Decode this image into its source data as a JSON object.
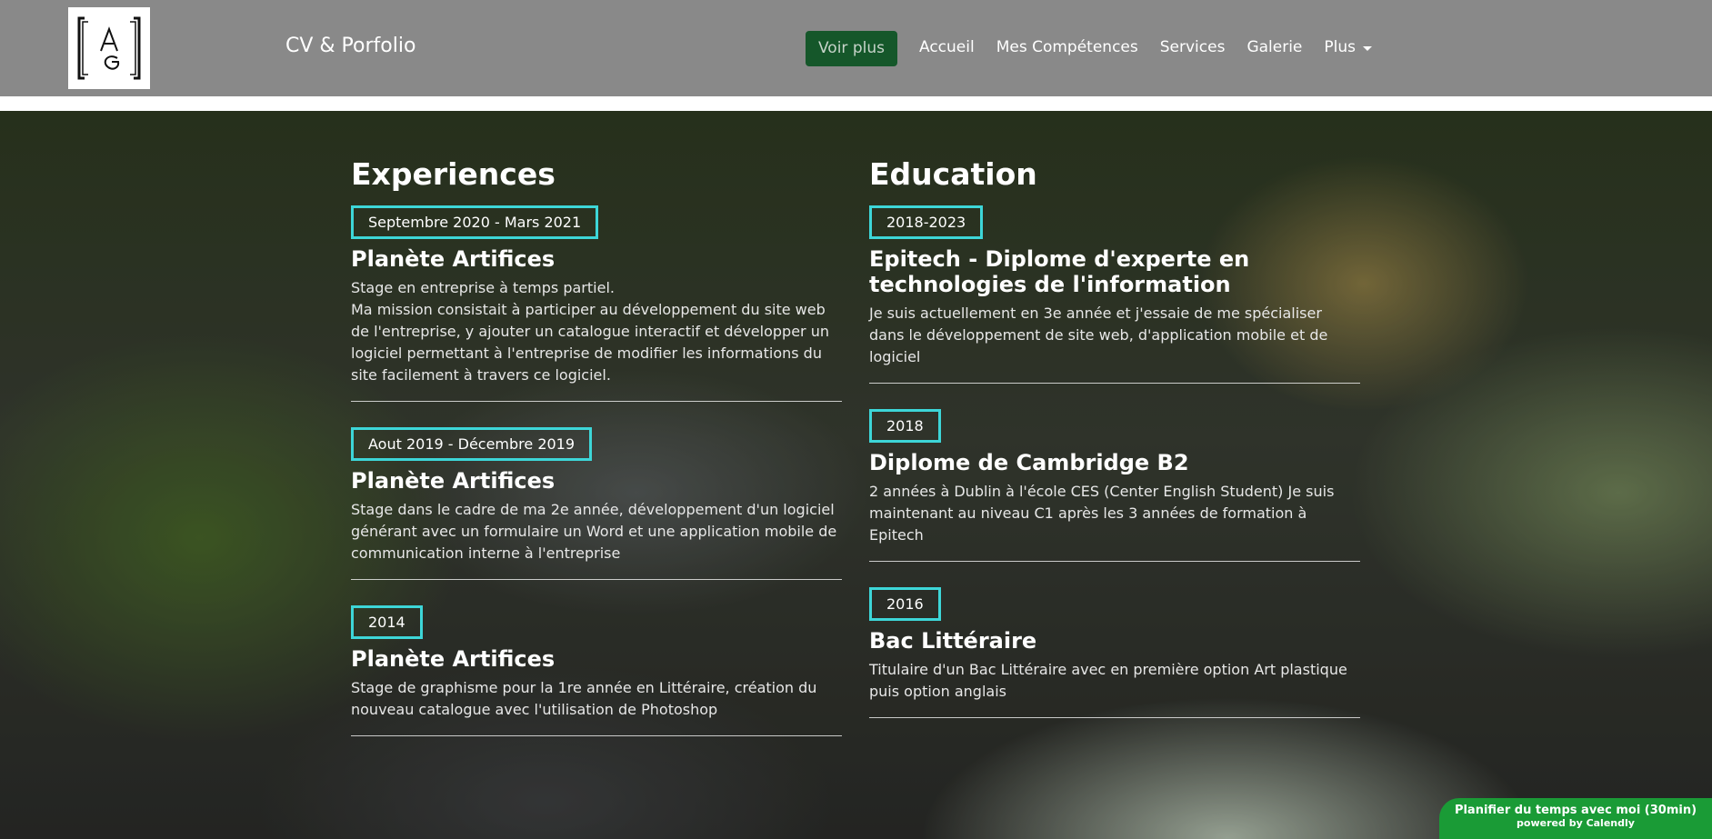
{
  "header": {
    "brand": "CV & Porfolio",
    "cta_label": "Voir plus",
    "nav": [
      "Accueil",
      "Mes Compétences",
      "Services",
      "Galerie"
    ],
    "more_label": "Plus",
    "logo_text": "AG"
  },
  "experiences": {
    "title": "Experiences",
    "items": [
      {
        "date": "Septembre 2020 - Mars 2021",
        "company": "Planète Artifices",
        "desc1": "Stage en entreprise à temps partiel.",
        "desc2": "Ma mission consistait à participer au développement du site web de l'entreprise, y ajouter un catalogue interactif et développer un logiciel permettant à l'entreprise de modifier les informations du site facilement à travers ce logiciel."
      },
      {
        "date": "Aout 2019 - Décembre 2019",
        "company": "Planète Artifices",
        "desc1": "Stage dans le cadre de ma 2e année, développement d'un logiciel générant avec un formulaire un Word et une application mobile de communication interne à l'entreprise"
      },
      {
        "date": "2014",
        "company": "Planète Artifices",
        "desc1": "Stage de graphisme pour la 1re année en Littéraire, création du nouveau catalogue avec l'utilisation de Photoshop"
      }
    ]
  },
  "education": {
    "title": "Education",
    "items": [
      {
        "date": "2018-2023",
        "school": "Epitech - Diplome d'experte en technologies de l'information",
        "desc": "Je suis actuellement en 3e année et j'essaie de me spécialiser dans le développement de site web, d'application mobile et de logiciel"
      },
      {
        "date": "2018",
        "school": "Diplome de Cambridge B2",
        "desc": "2 années à Dublin à l'école CES (Center English Student) Je suis maintenant au niveau C1 après les 3 années de formation à Epitech"
      },
      {
        "date": "2016",
        "school": "Bac Littéraire",
        "desc": "Titulaire d'un Bac Littéraire avec en première option Art plastique puis option anglais"
      }
    ]
  },
  "calendly": {
    "line1": "Planifier du temps avec moi (30min)",
    "line2": "powered by Calendly"
  },
  "colors": {
    "navbar": "#898989",
    "cta_bg": "#15572a",
    "badge_border": "#3dd6d8",
    "calendly_bg": "#1a9b36"
  }
}
